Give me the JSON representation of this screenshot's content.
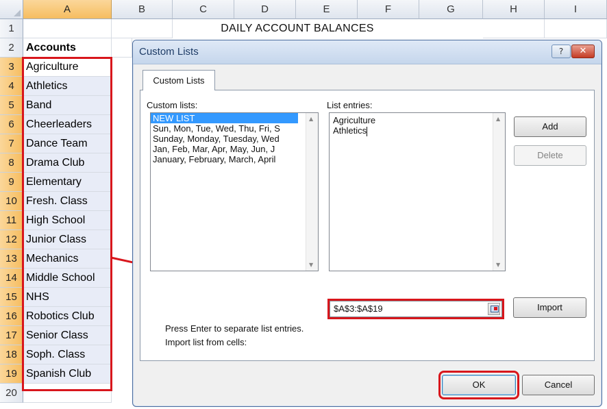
{
  "spreadsheet": {
    "columns": [
      "A",
      "B",
      "C",
      "D",
      "E",
      "F",
      "G",
      "H",
      "I"
    ],
    "rows": [
      "1",
      "2",
      "3",
      "4",
      "5",
      "6",
      "7",
      "8",
      "9",
      "10",
      "11",
      "12",
      "13",
      "14",
      "15",
      "16",
      "17",
      "18",
      "19",
      "20"
    ],
    "title": "DAILY ACCOUNT BALANCES",
    "header_cell": "Accounts",
    "accounts": [
      "Agriculture",
      "Athletics",
      "Band",
      "Cheerleaders",
      "Dance Team",
      "Drama Club",
      "Elementary",
      "Fresh. Class",
      "High School",
      "Junior Class",
      "Mechanics",
      "Middle School",
      "NHS",
      "Robotics Club",
      "Senior Class",
      "Soph. Class",
      "Spanish Club"
    ]
  },
  "dialog": {
    "title": "Custom Lists",
    "help_label": "?",
    "close_label": "✕",
    "tab_label": "Custom Lists",
    "custom_lists_label": "Custom lists:",
    "custom_lists": [
      "NEW LIST",
      "Sun, Mon, Tue, Wed, Thu, Fri, S",
      "Sunday, Monday, Tuesday, Wed",
      "Jan, Feb, Mar, Apr, May, Jun, J",
      "January, February, March, April"
    ],
    "list_entries_label": "List entries:",
    "list_entries": [
      "Agriculture",
      "Athletics"
    ],
    "add_label": "Add",
    "delete_label": "Delete",
    "hint": "Press Enter to separate list entries.",
    "import_label": "Import list from cells:",
    "import_range": "$A$3:$A$19",
    "import_button": "Import",
    "ok_label": "OK",
    "cancel_label": "Cancel"
  },
  "colors": {
    "highlight_red": "#d8161c",
    "selection_blue": "#3399ff"
  }
}
